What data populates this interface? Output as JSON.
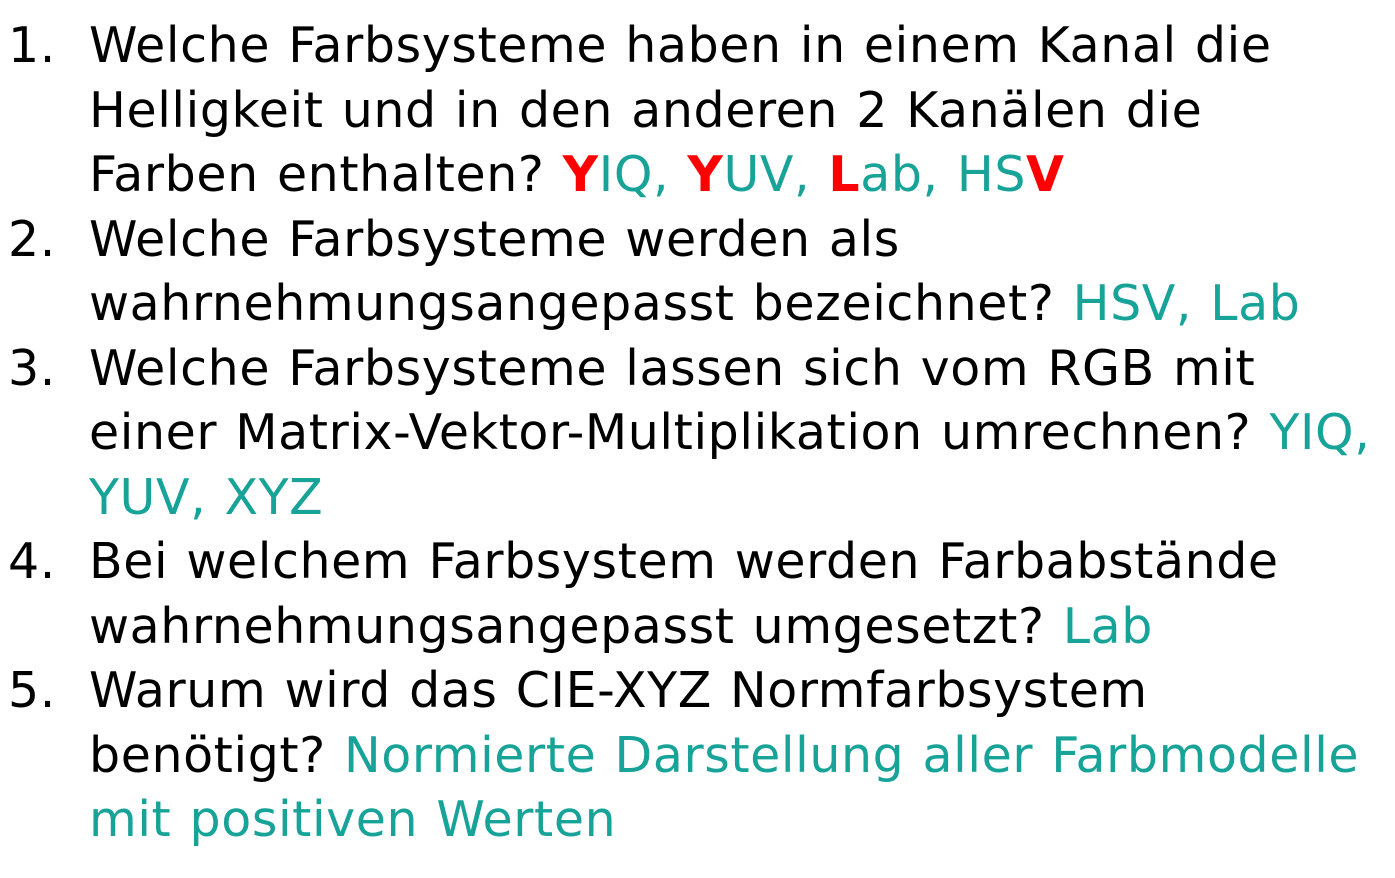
{
  "colors": {
    "question_text": "#000000",
    "answer_text": "#17a398",
    "highlight": "#ff0000",
    "background": "#ffffff"
  },
  "questions": [
    {
      "number": "1.",
      "text": "Welche Farbsysteme haben in einem Kanal die Helligkeit und in den anderen 2 Kanälen die Farben enthalten?",
      "answer_parts": [
        {
          "hl": "Y",
          "rest": "IQ, "
        },
        {
          "hl": "Y",
          "rest": "UV, "
        },
        {
          "hl": "L",
          "rest": "ab, "
        },
        {
          "rest": "HS",
          "hl": "V"
        }
      ]
    },
    {
      "number": "2.",
      "text": "Welche Farbsysteme werden als wahrnehmungsangepasst bezeichnet?",
      "answer": "HSV, Lab"
    },
    {
      "number": "3.",
      "text": "Welche Farbsysteme lassen sich vom RGB mit einer Matrix-Vektor-Multiplikation umrechnen?",
      "answer": "YIQ, YUV, XYZ"
    },
    {
      "number": "4.",
      "text": "Bei welchem Farbsystem werden Farbabstände wahrnehmungsangepasst umgesetzt?",
      "answer": "Lab"
    },
    {
      "number": "5.",
      "text": "Warum wird das CIE-XYZ Normfarbsystem benötigt?",
      "answer": "Normierte Darstellung aller Farbmodelle mit positiven Werten"
    }
  ]
}
